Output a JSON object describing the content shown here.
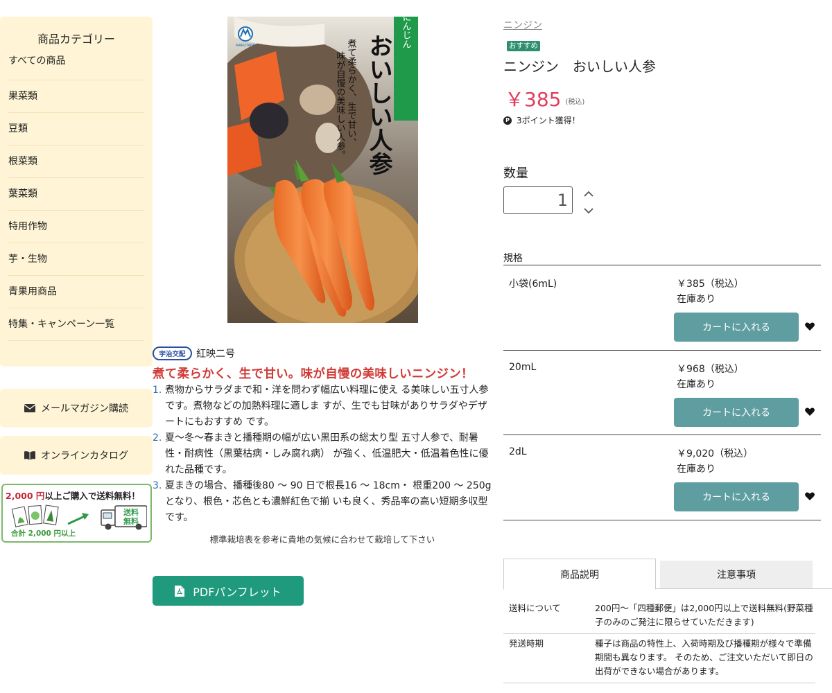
{
  "sidebar": {
    "heading": "商品カテゴリー",
    "items": [
      "すべての商品",
      "果菜類",
      "豆類",
      "根菜類",
      "葉菜類",
      "特用作物",
      "芋・生物",
      "青果用商品",
      "特集・キャンペーン一覧"
    ],
    "mail_label": "メールマガジン購読",
    "catalog_label": "オンラインカタログ",
    "shipping_banner": {
      "amount": "2,000 円",
      "text": "以上ご購入で送料無料！",
      "truck_label_1": "送料",
      "truck_label_2": "無料",
      "bottom_text": "合計 2,000 円以上"
    }
  },
  "product_image": {
    "vertical_label": "にんじん",
    "main_text": "おいしい人参",
    "tagline_1": "煮て柔らかく、生で甘い、",
    "tagline_2": "味が自慢の美味しい人参。",
    "logo_text": "MARUTANE"
  },
  "brand": {
    "badge": "宇治交配",
    "variety": "紅映二号"
  },
  "catchphrase": "煮て柔らかく、生で甘い。味が自慢の美味しいニンジン！",
  "features": [
    {
      "num": "1.",
      "text": "煮物からサラダまで和・洋を問わず幅広い料理に使え る美味しい五寸人参です。煮物などの加熱料理に適しま すが、生でも甘味がありサラダやデザートにもおすすめ です。"
    },
    {
      "num": "2.",
      "text": "夏〜冬〜春まきと播種期の幅が広い黒田系の総太り型 五寸人参で、耐暑性・耐病性（黒葉枯病・しみ腐れ病） が強く、低温肥大・低温着色性に優れた品種です。"
    },
    {
      "num": "3.",
      "text": "夏まきの場合、播種後80 〜 90 日で根長16 〜 18cm・ 根重200 〜 250g となり、根色・芯色とも濃鮮紅色で揃 いも良く、秀品率の高い短期多収型です。"
    }
  ],
  "cultivation_note": "標準栽培表を参考に貴地の気候に合わせて栽培して下さい",
  "pdf_button": "PDFパンフレット",
  "product": {
    "breadcrumb": "ニンジン",
    "badge": "おすすめ",
    "title": "ニンジン　おいしい人参",
    "price": "￥385",
    "tax_note": "(税込)",
    "points_icon": "P",
    "points": "3ポイント獲得！"
  },
  "quantity": {
    "label": "数量",
    "value": "1"
  },
  "spec": {
    "label": "規格",
    "rows": [
      {
        "name": "小袋(6mL)",
        "price": "￥385（税込）",
        "stock": "在庫あり",
        "cart": "カートに入れる"
      },
      {
        "name": "20mL",
        "price": "￥968（税込）",
        "stock": "在庫あり",
        "cart": "カートに入れる"
      },
      {
        "name": "2dL",
        "price": "￥9,020（税込）",
        "stock": "在庫あり",
        "cart": "カートに入れる"
      }
    ]
  },
  "tabs": [
    "商品説明",
    "注意事項"
  ],
  "info": [
    {
      "key": "送料について",
      "value": "200円〜「四種郵便」は2,000円以上で送料無料(野菜種子のみのご発注に限らせていただきます)"
    },
    {
      "key": "発送時期",
      "value": "種子は商品の特性上、入荷時期及び播種期が様々で準備期間も異なります。 そのため、ご注文いただいて即日の出荷ができない場合があります。"
    }
  ],
  "colors": {
    "sidebar_bg": "#fff5d6",
    "accent_green": "#1f9a7d",
    "cart_button": "#5f9ea0",
    "price_red": "#e23b5b",
    "catch_red": "#d03b36"
  }
}
